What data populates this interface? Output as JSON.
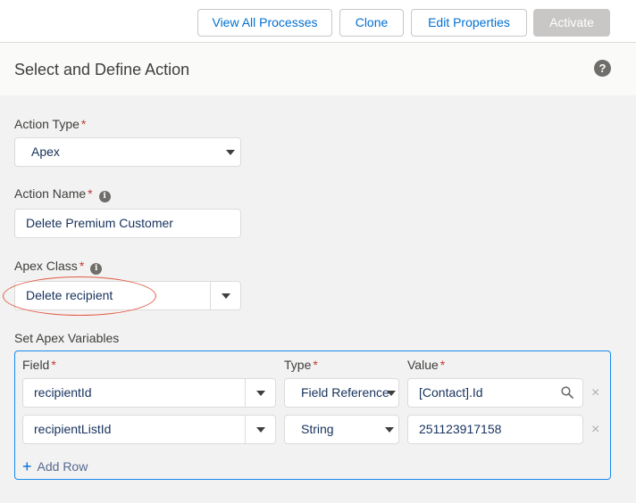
{
  "toolbar": {
    "view_all": "View All Processes",
    "clone": "Clone",
    "edit_properties": "Edit Properties",
    "activate": "Activate"
  },
  "header": {
    "title": "Select and Define Action",
    "help_icon": "?"
  },
  "form": {
    "action_type": {
      "label": "Action Type",
      "required": "*",
      "value": "Apex"
    },
    "action_name": {
      "label": "Action Name",
      "required": "*",
      "value": "Delete Premium Customer"
    },
    "apex_class": {
      "label": "Apex Class",
      "required": "*",
      "value": "Delete recipient"
    },
    "info_icon": "i"
  },
  "variables": {
    "section_label": "Set Apex Variables",
    "columns": {
      "field": "Field",
      "type": "Type",
      "value": "Value",
      "required": "*"
    },
    "rows": [
      {
        "field": "recipientId",
        "type": "Field Reference",
        "value": "[Contact].Id"
      },
      {
        "field": "recipientListId",
        "type": "String",
        "value": "251123917158"
      }
    ],
    "remove_icon": "×",
    "add_row": {
      "plus": "+",
      "label": "Add Row"
    }
  },
  "colors": {
    "accent": "#0070d2",
    "focus_border": "#1589ee",
    "required": "#c23934",
    "highlight": "#e05a44"
  }
}
